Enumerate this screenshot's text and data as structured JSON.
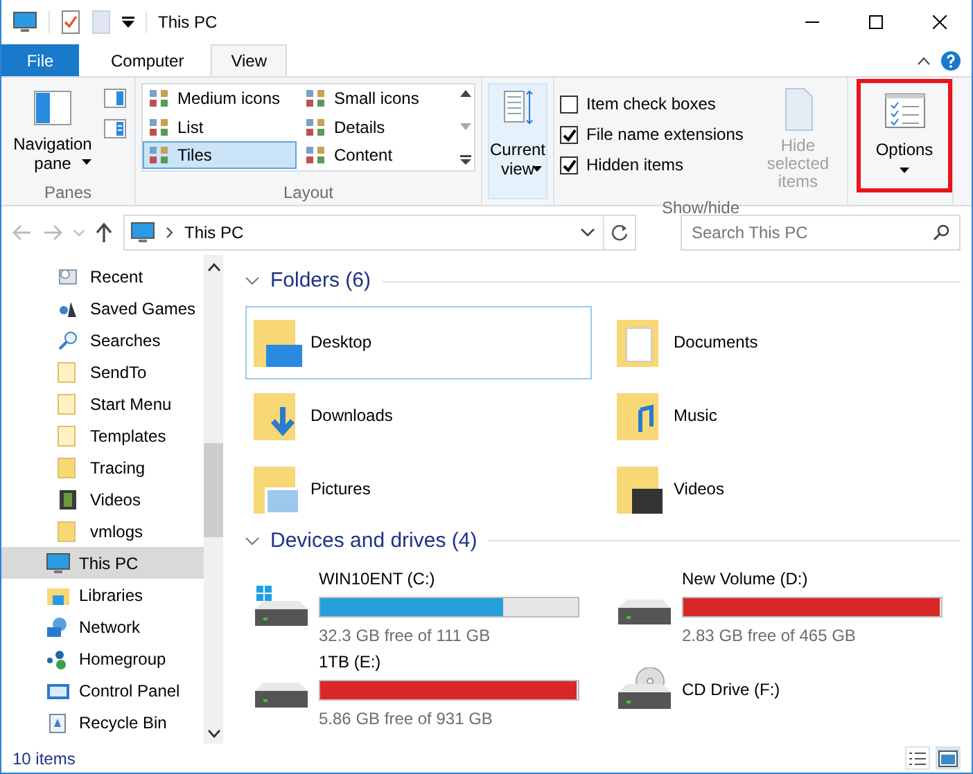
{
  "window": {
    "title": "This PC"
  },
  "ribbon_tabs": [
    {
      "label": "File",
      "kind": "file",
      "selected": false
    },
    {
      "label": "Computer",
      "kind": "tab",
      "selected": false
    },
    {
      "label": "View",
      "kind": "tab",
      "selected": true
    }
  ],
  "ribbon": {
    "panes": {
      "label": "Panes",
      "navigation_pane": "Navigation pane"
    },
    "layout": {
      "label": "Layout",
      "options": [
        {
          "label": "Medium icons",
          "selected": false
        },
        {
          "label": "Small icons",
          "selected": false
        },
        {
          "label": "List",
          "selected": false
        },
        {
          "label": "Details",
          "selected": false
        },
        {
          "label": "Tiles",
          "selected": true
        },
        {
          "label": "Content",
          "selected": false
        }
      ]
    },
    "current_view": {
      "label": "Current view"
    },
    "show_hide": {
      "label": "Show/hide",
      "checkboxes": [
        {
          "label": "Item check boxes",
          "checked": false
        },
        {
          "label": "File name extensions",
          "checked": true
        },
        {
          "label": "Hidden items",
          "checked": true
        }
      ],
      "hide_selected": {
        "label": "Hide selected items",
        "disabled": true
      }
    },
    "options": {
      "label": "Options",
      "highlighted": true
    }
  },
  "address_bar": {
    "path": "This PC",
    "search_placeholder": "Search This PC"
  },
  "nav_pane": {
    "scrolled_parent_children": [
      {
        "label": "Recent",
        "kind": "recent",
        "selected": false
      },
      {
        "label": "Saved Games",
        "kind": "games",
        "selected": false
      },
      {
        "label": "Searches",
        "kind": "search",
        "selected": false
      },
      {
        "label": "SendTo",
        "kind": "folder_pale",
        "selected": false
      },
      {
        "label": "Start Menu",
        "kind": "folder_pale",
        "selected": false
      },
      {
        "label": "Templates",
        "kind": "folder_pale",
        "selected": false
      },
      {
        "label": "Tracing",
        "kind": "folder",
        "selected": false
      },
      {
        "label": "Videos",
        "kind": "videos",
        "selected": false
      },
      {
        "label": "vmlogs",
        "kind": "folder",
        "selected": false
      }
    ],
    "items": [
      {
        "label": "This PC",
        "kind": "pc",
        "selected": true
      },
      {
        "label": "Libraries",
        "kind": "libraries",
        "selected": false
      },
      {
        "label": "Network",
        "kind": "network",
        "selected": false
      },
      {
        "label": "Homegroup",
        "kind": "homegroup",
        "selected": false
      },
      {
        "label": "Control Panel",
        "kind": "control_panel",
        "selected": false
      },
      {
        "label": "Recycle Bin",
        "kind": "recycle",
        "selected": false
      }
    ]
  },
  "folders": {
    "title": "Folders (6)",
    "expanded": true,
    "items": [
      {
        "name": "Desktop",
        "kind": "desktop",
        "selected": true
      },
      {
        "name": "Documents",
        "kind": "documents",
        "selected": false
      },
      {
        "name": "Downloads",
        "kind": "downloads",
        "selected": false
      },
      {
        "name": "Music",
        "kind": "music",
        "selected": false
      },
      {
        "name": "Pictures",
        "kind": "pictures",
        "selected": false
      },
      {
        "name": "Videos",
        "kind": "videos",
        "selected": false
      }
    ]
  },
  "drives": {
    "title": "Devices and drives (4)",
    "expanded": true,
    "items": [
      {
        "name": "WIN10ENT (C:)",
        "kind": "system",
        "level": 0.71,
        "low_space": false,
        "free": "32.3 GB free of 111 GB"
      },
      {
        "name": "New Volume (D:)",
        "kind": "hdd",
        "level": 0.994,
        "low_space": true,
        "free": "2.83 GB free of 465 GB"
      },
      {
        "name": "1TB (E:)",
        "kind": "hdd",
        "level": 0.994,
        "low_space": true,
        "free": "5.86 GB free of 931 GB"
      },
      {
        "name": "CD Drive (F:)",
        "kind": "cd"
      }
    ]
  },
  "status_bar": {
    "item_count": "10 items",
    "views": [
      {
        "kind": "details",
        "selected": false
      },
      {
        "kind": "tiles",
        "selected": true
      }
    ]
  }
}
